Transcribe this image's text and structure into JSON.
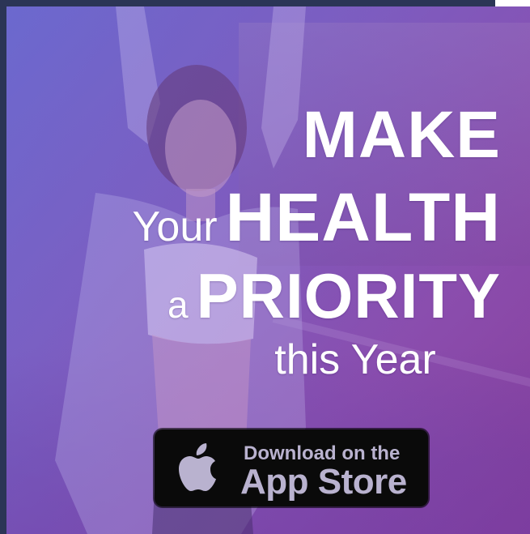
{
  "ad": {
    "headline": {
      "make": "MAKE",
      "your": "Your",
      "health": "HEALTH",
      "a": "a",
      "priority": "PRIORITY",
      "this_year": "this Year"
    },
    "store_button": {
      "top_text": "Download on the",
      "bottom_text": "App Store",
      "icon": "apple-icon"
    },
    "colors": {
      "overlay_start": "#6a66c7",
      "overlay_end": "#7d3f92",
      "button_bg": "#0a0a0a",
      "button_text": "#b9b2cf",
      "headline_text": "#ffffff"
    }
  }
}
